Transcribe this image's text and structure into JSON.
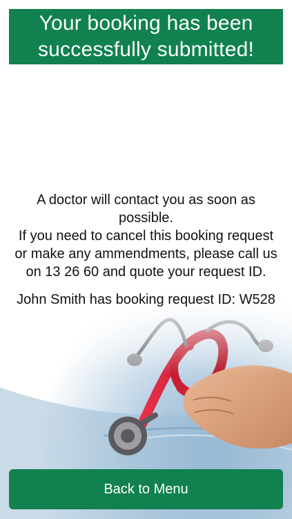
{
  "header": {
    "title": "Your booking has been successfully submitted!"
  },
  "message": {
    "line1": "A doctor will contact you as soon as possible.",
    "line2": "If you need to cancel this booking request or make any ammendments, please call us on 13 26 60 and quote your request ID.",
    "booking_info": "John Smith has booking request ID: W528"
  },
  "footer": {
    "back_label": "Back to Menu"
  },
  "colors": {
    "brand_green": "#118150",
    "text_dark": "#111111",
    "scrub_blue": "#a9c7dd",
    "stethoscope_red": "#d9253a"
  },
  "background": {
    "icon": "doctor-stethoscope-photo"
  }
}
